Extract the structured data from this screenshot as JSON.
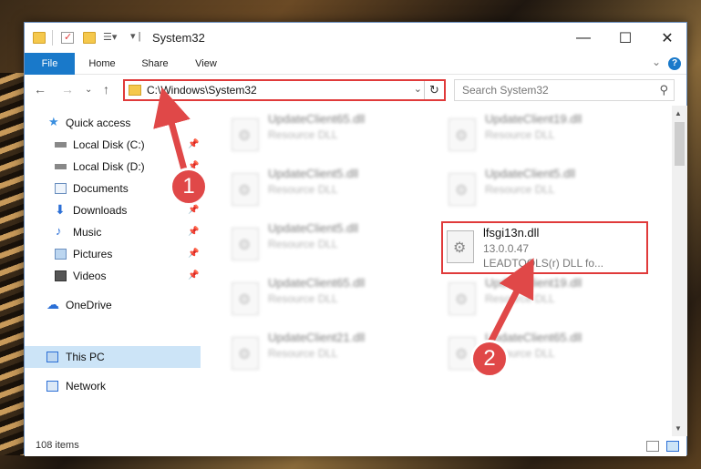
{
  "window": {
    "title": "System32",
    "controls": {
      "minimize": "—",
      "maximize": "☐",
      "close": "✕"
    }
  },
  "ribbon": {
    "tabs": [
      "File",
      "Home",
      "Share",
      "View"
    ],
    "help": "?"
  },
  "nav": {
    "address_path": "C:\\Windows\\System32",
    "search_placeholder": "Search System32"
  },
  "sidebar": {
    "items": [
      {
        "label": "Quick access",
        "icon": "star-icon"
      },
      {
        "label": "Local Disk (C:)",
        "icon": "drive-icon",
        "pinned": true
      },
      {
        "label": "Local Disk (D:)",
        "icon": "drive-icon",
        "pinned": true
      },
      {
        "label": "Documents",
        "icon": "documents-icon",
        "pinned": true
      },
      {
        "label": "Downloads",
        "icon": "download-icon",
        "pinned": true
      },
      {
        "label": "Music",
        "icon": "music-icon",
        "pinned": true
      },
      {
        "label": "Pictures",
        "icon": "pictures-icon",
        "pinned": true
      },
      {
        "label": "Videos",
        "icon": "videos-icon",
        "pinned": true
      },
      {
        "label": "OneDrive",
        "icon": "cloud-icon"
      },
      {
        "label": "This PC",
        "icon": "computer-icon",
        "selected": true
      },
      {
        "label": "Network",
        "icon": "network-icon"
      }
    ]
  },
  "files": [
    {
      "name": "UpdateClient65.dll",
      "type": "Resource DLL"
    },
    {
      "name": "UpdateClient19.dll",
      "type": "Resource DLL"
    },
    {
      "name": "UpdateClient5.dll",
      "type": "Resource DLL"
    },
    {
      "name": "UpdateClient5.dll",
      "type": "Resource DLL"
    },
    {
      "name": "UpdateClient5.dll",
      "type": "Resource DLL"
    },
    {
      "name": "lfsgi13n.dll",
      "version": "13.0.0.47",
      "desc": "LEADTOOLS(r) DLL fo...",
      "highlighted": true
    },
    {
      "name": "UpdateClient65.dll",
      "type": "Resource DLL"
    },
    {
      "name": "UpdateClient19.dll",
      "type": "Resource DLL"
    },
    {
      "name": "UpdateClient21.dll",
      "type": "Resource DLL"
    },
    {
      "name": "UpdateClient65.dll",
      "type": "Resource DLL"
    }
  ],
  "status": {
    "item_count": "108 items"
  },
  "annotations": {
    "badge1": "1",
    "badge2": "2",
    "color": "#e04848"
  }
}
